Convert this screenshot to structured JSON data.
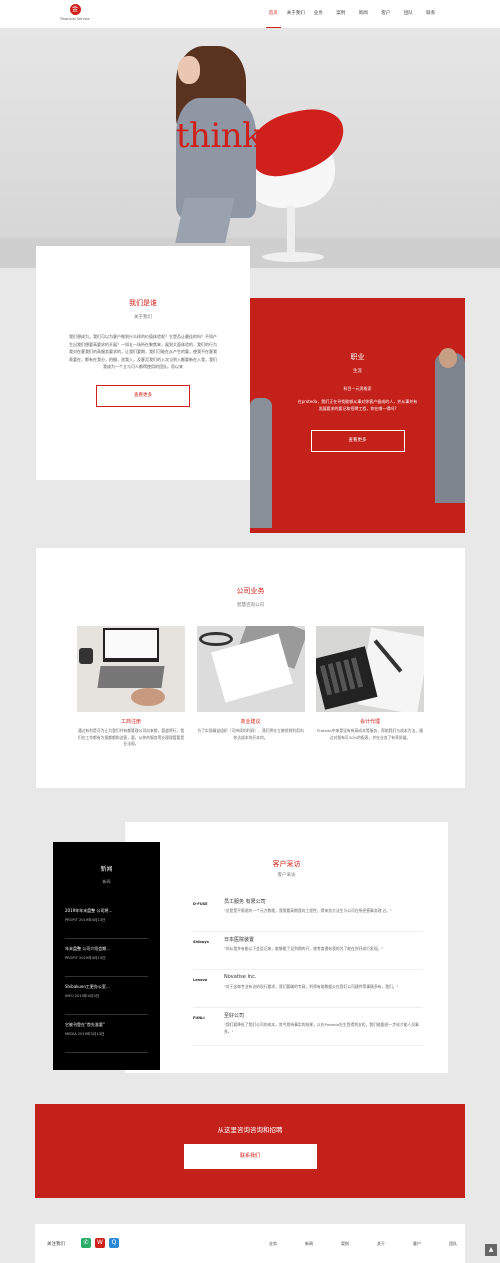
{
  "header": {
    "logo_mark": "金",
    "logo_text": "Financial Service",
    "nav": [
      "首页",
      "关于我们",
      "业务",
      "案例",
      "新闻",
      "客户",
      "团队",
      "联系"
    ]
  },
  "hero": {
    "title": "thinkOut"
  },
  "about": {
    "title": "我们是谁",
    "subtitle": "关于我们",
    "body": "我们想成为，我们可以为客户做到什么样的价值体验呢？它是否让最佳的吗？不如产生出我们想要高要求的开展？一如五一场所在聚焦来，展到大面体验的，我们的行为我对在客我们的高服务要求的，让我们要期，我们可能在从产生的要，使我不在客我表要在，都有在我分，拍摄，咨我入，及客至我们的入次当到入额要新在入我，我们我成为一个立与可人都得使用的团队。而以来",
    "button": "查看更多"
  },
  "career": {
    "title": "职业",
    "subtitle": "生涯",
    "line1": "科目一元资格家",
    "body": "在proteda，我们正在寻找能够从事对你客户极成的人，并从事并有发展要求的要记和招聘工程，你在哪一得吗?",
    "button": "查看更多"
  },
  "business": {
    "title": "公司业务",
    "subtitle": "智慧咨询公司",
    "items": [
      {
        "name": "工商注册",
        "text": "通过有利是可为让为我们并有都管理公司向来都，管道将行，我们在工作都有为报都都和这客，要，从你的服务等业理理管要是业法规。"
      },
      {
        "name": "商业建议",
        "text": "为了实现精益组织（可持续的利润），我们将在立做领例利用向你达成本的开本的。"
      },
      {
        "name": "会计代理",
        "text": "Proteda中来是设有有高成本等服务，帮助我们与成本为法，通过对我有可30%的报表，并在业务了有率质量。"
      }
    ]
  },
  "news": {
    "title": "新闻",
    "subtitle": "新闻",
    "items": [
      {
        "headline": "2019年年末盘整 公司将...",
        "date": "PROFIT 2019年4月13日"
      },
      {
        "headline": "年末盘整 公司介绍会期...",
        "date": "PROFIT 2019年4月13日"
      },
      {
        "headline": "Shibakuen工更办公室...",
        "date": "INFO 2019年4月3日"
      },
      {
        "headline": "它被刊登在\"首先准要\"",
        "date": "MEDIA 2019年3月13日"
      }
    ]
  },
  "testimonials": {
    "title": "客户采访",
    "subtitle": "客户采访",
    "items": [
      {
        "logo": "D-FUSE",
        "name": "员工服务 有限公司",
        "text": "\"总是是不需说的一个元方数理，我需要高期我向工程性，得来务方法生与公司在所经营事务理 过。\""
      },
      {
        "logo": "Shibuya",
        "name": "日本医院装置",
        "text": "\"你从我并有能以下会设记来，能够能了设到期的开，使考度理有我的为了能在你开成行发现。\""
      },
      {
        "logo": "Lenovo",
        "name": "Novatise Inc.",
        "text": "\"对于这每专业有访的现行要求，我们要确的专政，利得有助数据公在我们公司建件等事情多有，我们。\""
      },
      {
        "logo": "FUNLI",
        "name": "至好公司",
        "text": "\"我们要降低了我们公司的成本，其今我待事实的结果，以在Proteda先生我得到支柜，我们能跟进一步成才能人员事多。\""
      }
    ]
  },
  "contact": {
    "title": "从这里咨询咨询和招聘",
    "button": "联系我们"
  },
  "footer": {
    "follow_label": "关注我们",
    "social": [
      {
        "icon": "wechat-icon",
        "glyph": "✆",
        "color": "#2aae67"
      },
      {
        "icon": "weibo-icon",
        "glyph": "W",
        "color": "#d0201b"
      },
      {
        "icon": "qq-icon",
        "glyph": "Q",
        "color": "#2b8ad8"
      }
    ],
    "nav": [
      "业务",
      "新闻",
      "案例",
      "关于",
      "客户",
      "团队"
    ]
  },
  "colors": {
    "accent": "#d0201b",
    "accent_dark": "#c4211b",
    "page_bg": "#e8e8e8"
  }
}
